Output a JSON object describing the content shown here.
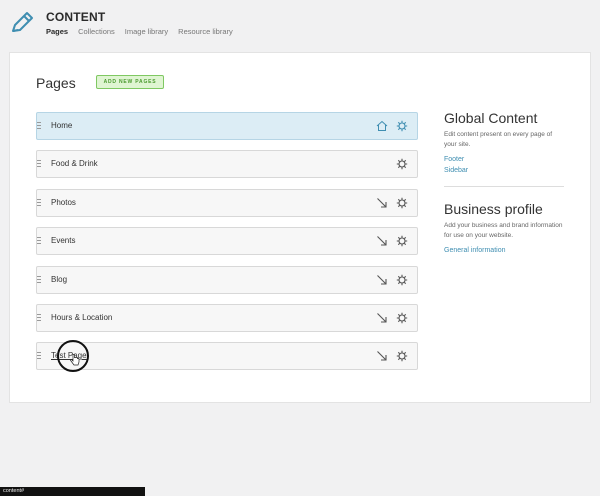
{
  "app": {
    "title": "CONTENT",
    "nav": [
      {
        "label": "Pages",
        "active": true
      },
      {
        "label": "Collections",
        "active": false
      },
      {
        "label": "Image library",
        "active": false
      },
      {
        "label": "Resource library",
        "active": false
      }
    ]
  },
  "main": {
    "heading": "Pages",
    "add_button": "ADD NEW PAGES",
    "pages": [
      {
        "label": "Home",
        "icon": "home-icon"
      },
      {
        "label": "Food & Drink",
        "icon": null
      },
      {
        "label": "Photos",
        "icon": "arrow-down-right-icon"
      },
      {
        "label": "Events",
        "icon": "arrow-down-right-icon"
      },
      {
        "label": "Blog",
        "icon": "arrow-down-right-icon"
      },
      {
        "label": "Hours & Location",
        "icon": "arrow-down-right-icon"
      },
      {
        "label": "Test Page",
        "icon": "arrow-down-right-icon"
      }
    ]
  },
  "sidebar": {
    "global": {
      "title": "Global Content",
      "description": "Edit content present on every page of your site.",
      "links": [
        "Footer",
        "Sidebar"
      ]
    },
    "business": {
      "title": "Business profile",
      "description": "Add your business and brand information for use on your website.",
      "links": [
        "General information"
      ]
    }
  },
  "status": {
    "url": "content#"
  },
  "colors": {
    "accent_link": "#3f8eb1",
    "home_row_bg": "#dcedf5",
    "add_button_bg": "#dff5d2",
    "add_button_text": "#4a9a2e"
  }
}
